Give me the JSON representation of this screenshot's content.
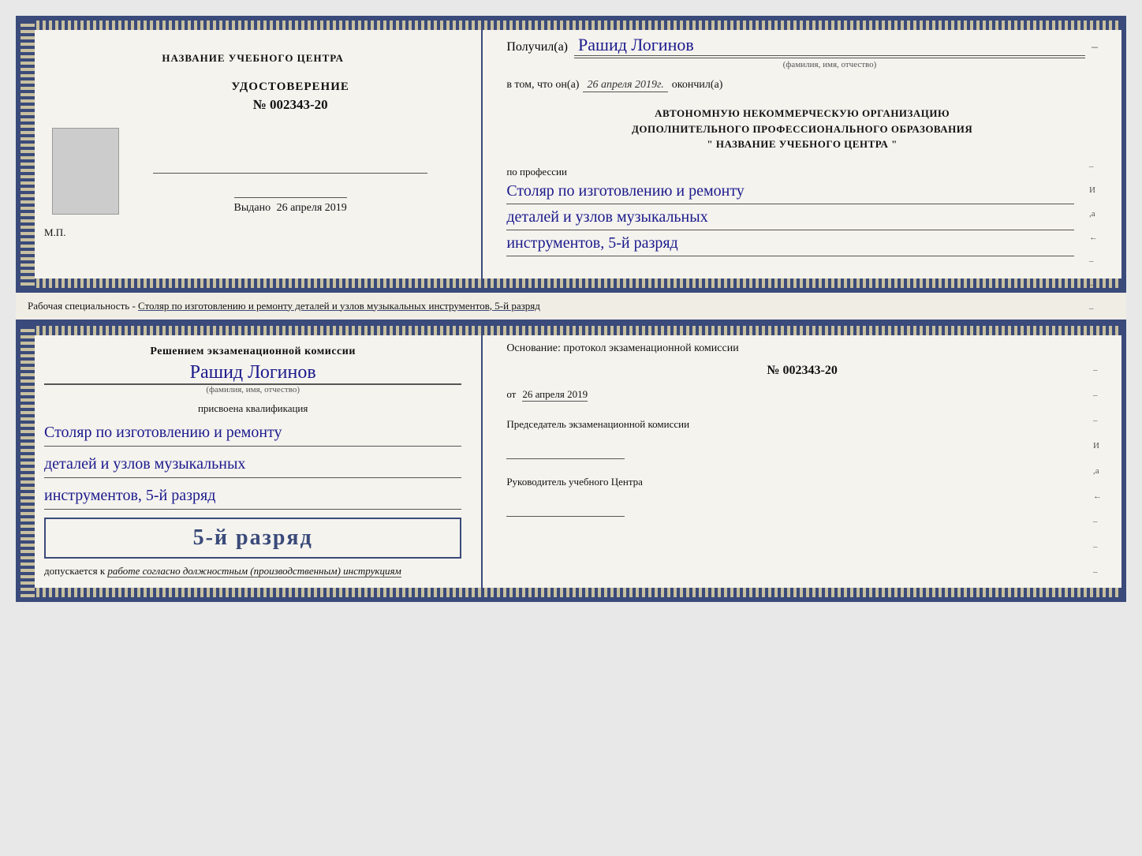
{
  "top_doc": {
    "left": {
      "center_title": "НАЗВАНИЕ УЧЕБНОГО ЦЕНТРА",
      "udostoverenie_title": "УДОСТОВЕРЕНИЕ",
      "udostoverenie_num": "№ 002343-20",
      "vydano_label": "Выдано",
      "vydano_date": "26 апреля 2019",
      "mp": "М.П."
    },
    "right": {
      "poluchil_label": "Получил(а)",
      "name_handwritten": "Рашид Логинов",
      "name_hint": "(фамилия, имя, отчество)",
      "vtom_label": "в том, что он(а)",
      "date_value": "26 апреля 2019г.",
      "okkonchil": "окончил(а)",
      "org_line1": "АВТОНОМНУЮ НЕКОММЕРЧЕСКУЮ ОРГАНИЗАЦИЮ",
      "org_line2": "ДОПОЛНИТЕЛЬНОГО ПРОФЕССИОНАЛЬНОГО ОБРАЗОВАНИЯ",
      "org_line3": "\"  НАЗВАНИЕ УЧЕБНОГО ЦЕНТРА  \"",
      "po_professii": "по профессии",
      "profession_line1": "Столяр по изготовлению и ремонту",
      "profession_line2": "деталей и узлов музыкальных",
      "profession_line3": "инструментов, 5-й разряд"
    }
  },
  "middle_label": {
    "text_prefix": "Рабочая специальность - ",
    "text_underlined": "Столяр по изготовлению и ремонту деталей и узлов музыкальных инструментов, 5-й разряд"
  },
  "bottom_doc": {
    "left": {
      "resheniem": "Решением экзаменационной комиссии",
      "name_handwritten": "Рашид Логинов",
      "name_hint": "(фамилия, имя, отчество)",
      "prisvoyena": "присвоена квалификация",
      "qual_line1": "Столяр по изготовлению и ремонту",
      "qual_line2": "деталей и узлов музыкальных",
      "qual_line3": "инструментов, 5-й разряд",
      "razryad_big": "5-й разряд",
      "dopuskaetsya_prefix": "допускается к",
      "dopuskaetsya_underline": "работе согласно должностным (производственным) инструкциям"
    },
    "right": {
      "osnovanie": "Основание: протокол экзаменационной комиссии",
      "protokol_num": "№ 002343-20",
      "ot_label": "от",
      "ot_date": "26 апреля 2019",
      "predsedatel_title": "Председатель экзаменационной комиссии",
      "rukovoditel_title": "Руководитель учебного Центра"
    }
  }
}
